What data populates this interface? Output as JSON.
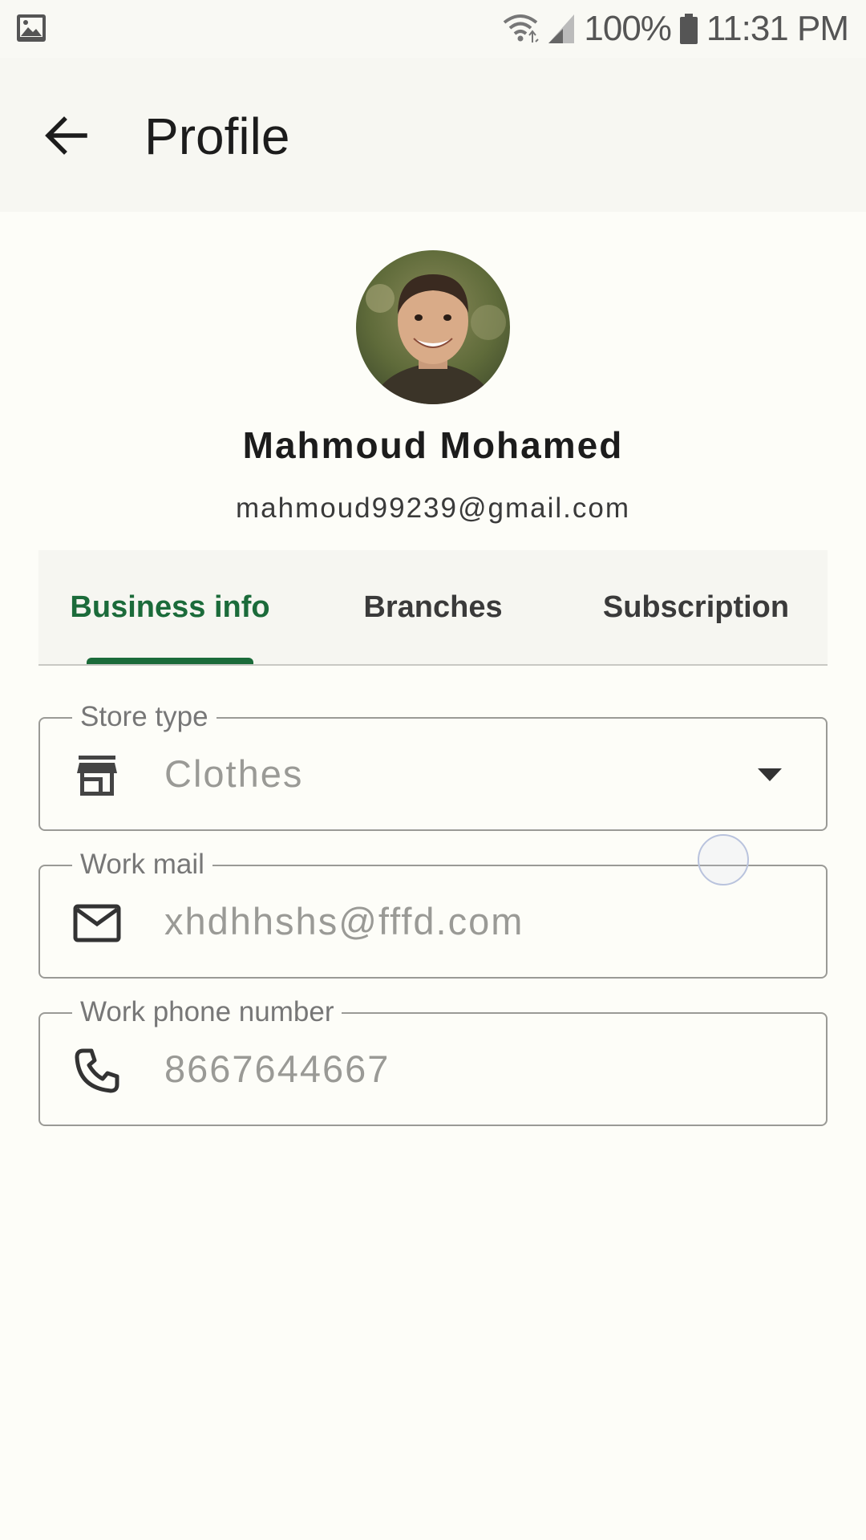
{
  "status_bar": {
    "battery": "100%",
    "time": "11:31 PM"
  },
  "app_bar": {
    "title": "Profile"
  },
  "profile": {
    "name": "Mahmoud Mohamed",
    "email": "mahmoud99239@gmail.com"
  },
  "tabs": [
    {
      "label": "Business info",
      "active": true
    },
    {
      "label": "Branches",
      "active": false
    },
    {
      "label": "Subscription",
      "active": false
    }
  ],
  "fields": {
    "store_type": {
      "label": "Store type",
      "value": "Clothes",
      "icon": "store-icon"
    },
    "work_mail": {
      "label": "Work mail",
      "value": "xhdhhshs@fffd.com",
      "icon": "mail-icon"
    },
    "work_phone": {
      "label": "Work phone number",
      "value": "8667644667",
      "icon": "phone-icon"
    }
  },
  "colors": {
    "accent": "#1b6b3a",
    "background": "#fdfdf8"
  }
}
